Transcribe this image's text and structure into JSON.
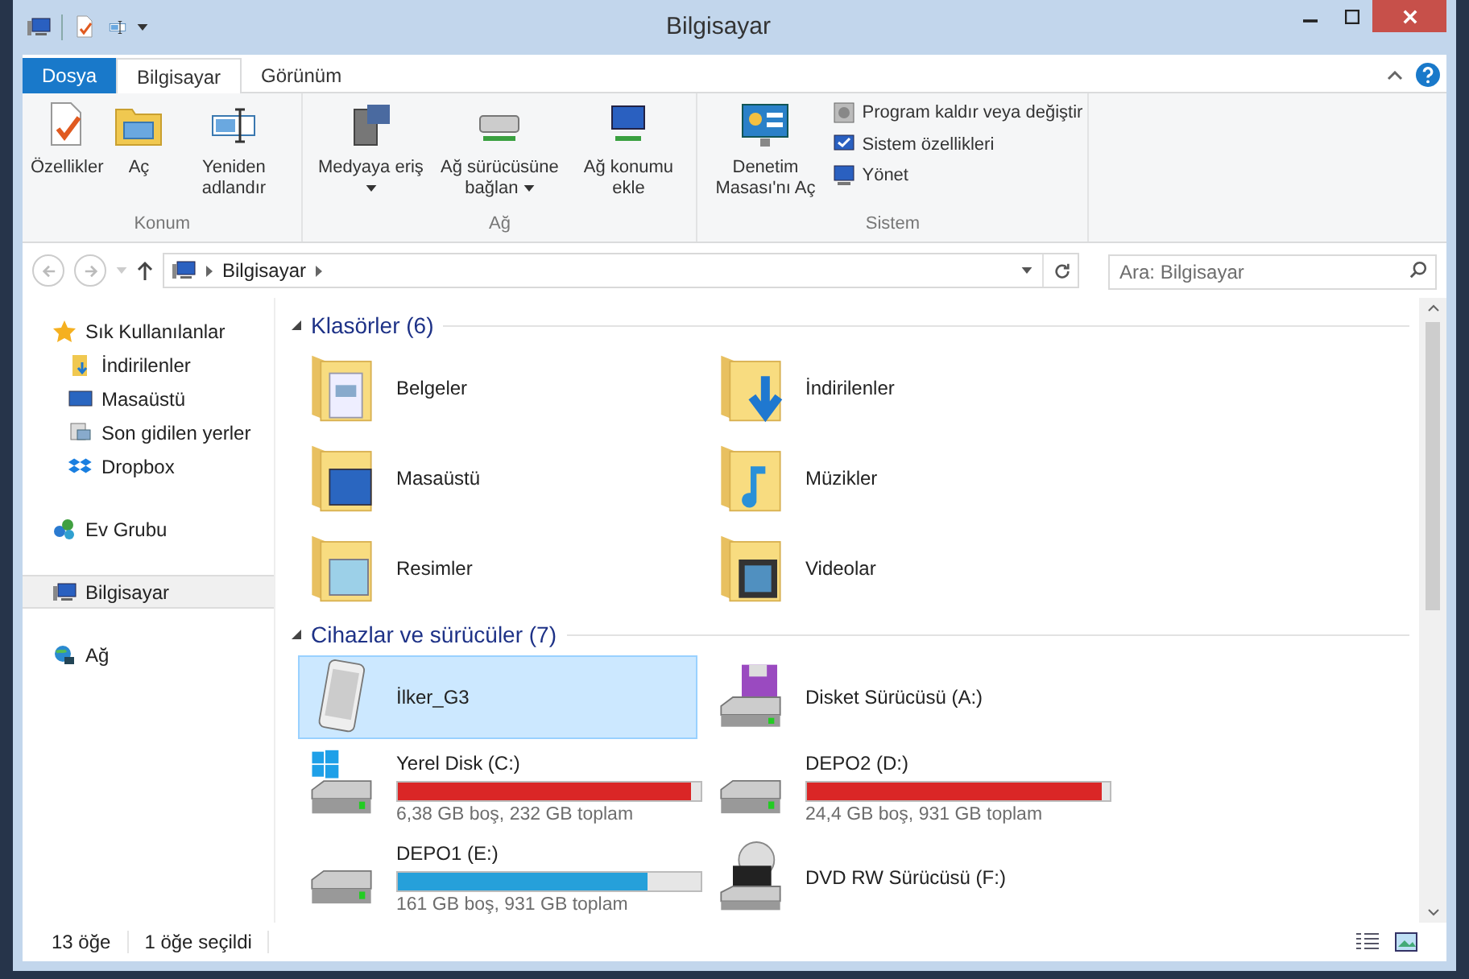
{
  "window": {
    "title": "Bilgisayar"
  },
  "tabs": [
    {
      "label": "Dosya",
      "kind": "file",
      "selected": false
    },
    {
      "label": "Bilgisayar",
      "kind": "tab",
      "selected": true
    },
    {
      "label": "Görünüm",
      "kind": "tab",
      "selected": false
    }
  ],
  "ribbon": {
    "groups": [
      {
        "label": "Konum",
        "items": [
          {
            "kind": "large",
            "label": "Özellikler",
            "has_menu": false
          },
          {
            "kind": "large",
            "label": "Aç",
            "has_menu": false
          },
          {
            "kind": "large",
            "label": "Yeniden adlandır",
            "has_menu": false
          }
        ]
      },
      {
        "label": "Ağ",
        "items": [
          {
            "kind": "large",
            "label": "Medyaya eriş",
            "has_menu": true
          },
          {
            "kind": "large",
            "label": "Ağ sürücüsüne bağlan",
            "has_menu": true
          },
          {
            "kind": "large",
            "label": "Ağ konumu ekle",
            "has_menu": false
          }
        ]
      },
      {
        "label": "Sistem",
        "items": [
          {
            "kind": "large",
            "label": "Denetim Masası'nı Aç",
            "has_menu": false
          },
          {
            "kind": "small",
            "label": "Program kaldır veya değiştir",
            "has_menu": false
          },
          {
            "kind": "small",
            "label": "Sistem özellikleri",
            "has_menu": false
          },
          {
            "kind": "small",
            "label": "Yönet",
            "has_menu": false
          }
        ]
      }
    ]
  },
  "address_bar": {
    "path": [
      "Bilgisayar"
    ]
  },
  "search": {
    "placeholder": "Ara: Bilgisayar"
  },
  "sidebar": {
    "groups": [
      {
        "items": [
          {
            "label": "Sık Kullanılanlar",
            "selected": false,
            "children": [
              {
                "label": "İndirilenler",
                "selected": false
              },
              {
                "label": "Masaüstü",
                "selected": false
              },
              {
                "label": "Son gidilen yerler",
                "selected": false
              },
              {
                "label": "Dropbox",
                "selected": false
              }
            ]
          }
        ]
      },
      {
        "items": [
          {
            "label": "Ev Grubu",
            "selected": false
          }
        ]
      },
      {
        "items": [
          {
            "label": "Bilgisayar",
            "selected": true
          }
        ]
      },
      {
        "items": [
          {
            "label": "Ağ",
            "selected": false
          }
        ]
      }
    ]
  },
  "sections": [
    {
      "title": "Klasörler (6)",
      "items": [
        {
          "kind": "folder",
          "name": "Belgeler",
          "selected": false
        },
        {
          "kind": "folder",
          "name": "İndirilenler",
          "selected": false
        },
        {
          "kind": "folder",
          "name": "Masaüstü",
          "selected": false
        },
        {
          "kind": "folder",
          "name": "Müzikler",
          "selected": false
        },
        {
          "kind": "folder",
          "name": "Resimler",
          "selected": false
        },
        {
          "kind": "folder",
          "name": "Videolar",
          "selected": false
        }
      ]
    },
    {
      "title": "Cihazlar ve sürücüler (7)",
      "items": [
        {
          "kind": "phone",
          "name": "İlker_G3",
          "selected": true
        },
        {
          "kind": "floppy",
          "name": "Disket Sürücüsü (A:)",
          "selected": false
        },
        {
          "kind": "drive",
          "name": "Yerel Disk (C:)",
          "level": 0.97,
          "color": "#da2626",
          "space": "6,38 GB boş, 232 GB toplam",
          "selected": false
        },
        {
          "kind": "drive",
          "name": "DEPO2 (D:)",
          "level": 0.974,
          "color": "#da2626",
          "space": "24,4 GB boş, 931 GB toplam",
          "selected": false
        },
        {
          "kind": "drive",
          "name": "DEPO1 (E:)",
          "level": 0.827,
          "color": "#26a0da",
          "space": "161 GB boş, 931 GB toplam",
          "selected": false
        },
        {
          "kind": "dvd",
          "name": "DVD RW Sürücüsü (F:)",
          "selected": false
        }
      ]
    }
  ],
  "status_bar": {
    "items": [
      "13 öğe",
      "1 öğe seçildi"
    ]
  }
}
